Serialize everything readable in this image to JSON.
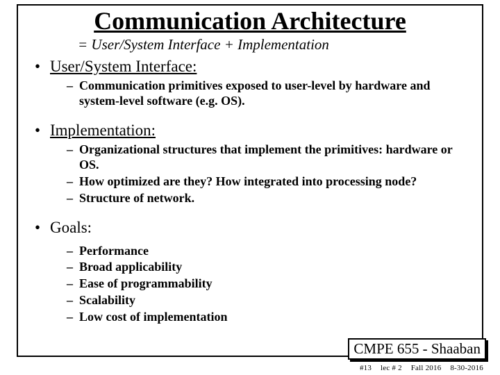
{
  "title": "Communication Architecture",
  "subtitle": "=  User/System Interface + Implementation",
  "sections": {
    "a": {
      "heading": "User/System Interface:",
      "items": {
        "a1": "Communication primitives exposed to user-level by hardware and system-level software (e.g. OS)."
      }
    },
    "b": {
      "heading": "Implementation:",
      "items": {
        "b1": "Organizational structures that implement the primitives:  hardware or OS.",
        "b2": "How optimized are they? How integrated into processing node?",
        "b3": "Structure of network."
      }
    },
    "c": {
      "heading": "Goals:",
      "items": {
        "c1": "Performance",
        "c2": "Broad applicability",
        "c3": "Ease of programmability",
        "c4": "Scalability",
        "c5": "Low cost of implementation"
      }
    }
  },
  "footer": {
    "course": "CMPE 655 - Shaaban",
    "slide_no": "#13",
    "lec": "lec # 2",
    "term": "Fall 2016",
    "date": "8-30-2016"
  }
}
